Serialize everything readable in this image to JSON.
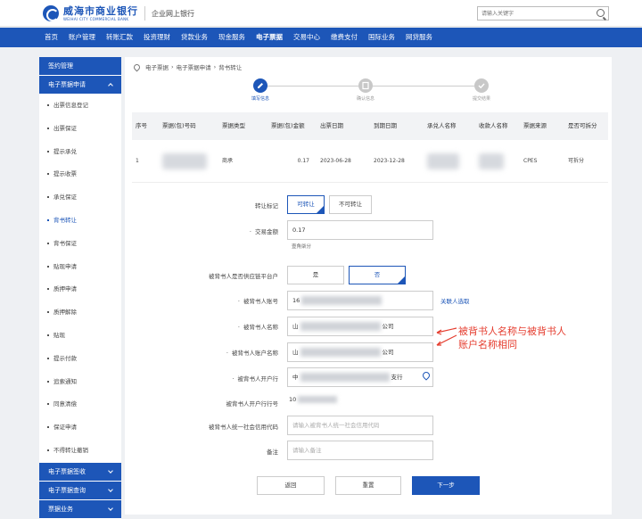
{
  "header": {
    "logo_cn": "威海市商业银行",
    "logo_en": "WEIHAI CITY COMMERCIAL BANK",
    "subtitle": "企业网上银行",
    "search_placeholder": "请输入关键字"
  },
  "nav": [
    "首页",
    "账户管理",
    "转账汇款",
    "投资理财",
    "贷款业务",
    "现金服务",
    "电子票据",
    "交易中心",
    "缴费支付",
    "国际业务",
    "网贷服务"
  ],
  "sidebar": {
    "section_sign": "签约管理",
    "section_apply": "电子票据申请",
    "items": [
      "出票信息登记",
      "出票保证",
      "提示承兑",
      "提示收票",
      "承兑保证",
      "背书转让",
      "背书保证",
      "贴现申请",
      "质押申请",
      "质押解除",
      "贴现",
      "提示付款",
      "追索通知",
      "同意清偿",
      "保证申请",
      "不得转让撤销"
    ],
    "section_sign2": "电子票据签收",
    "section_query": "电子票据查询",
    "section_more": "票据业务"
  },
  "breadcrumb": [
    "电子票据",
    "电子票据申请",
    "背书转让"
  ],
  "steps": [
    "填写信息",
    "确认信息",
    "提交结果"
  ],
  "table": {
    "headers": [
      "序号",
      "票据(包)号码",
      "票据类型",
      "票据(包)金额",
      "出票日期",
      "到期日期",
      "承兑人名称",
      "收款人名称",
      "票据来源",
      "是否可拆分"
    ],
    "row": {
      "seq": "1",
      "bill_type": "商承",
      "amount": "0.17",
      "issue_date": "2023-06-28",
      "due_date": "2023-12-28",
      "source": "CPES",
      "splittable": "可拆分"
    }
  },
  "form": {
    "transfer_mark_label": "转让标记",
    "transfer_yes": "可转让",
    "transfer_no": "不可转让",
    "amount_label": "交易金额",
    "amount_value": "0.17",
    "amount_hint": "壹角柒分",
    "platform_label": "被背书人是否供应链平台户",
    "platform_yes": "是",
    "platform_no": "否",
    "acct_no_label": "被背书人账号",
    "acct_no_value": "16",
    "contact_link": "关联人选取",
    "name_label": "被背书人名称",
    "name_prefix": "山",
    "name_suffix": "公司",
    "acct_name_label": "被背书人账户名称",
    "acct_name_prefix": "山",
    "acct_name_suffix": "公司",
    "bank_label": "被背书人开户行",
    "bank_prefix": "中",
    "bank_suffix": "支行",
    "bank_code_label": "被背书人开户行行号",
    "bank_code_value": "10",
    "credit_code_label": "被背书人统一社会信用代码",
    "credit_code_placeholder": "请输入被背书人统一社会信用代码",
    "remark_label": "备注",
    "remark_placeholder": "请输入备注"
  },
  "annotation": [
    "被背书人名称与被背书人",
    "账户名称相同"
  ],
  "buttons": {
    "back": "返回",
    "reset": "重置",
    "next": "下一步"
  },
  "colors": {
    "primary": "#1d56b8",
    "annotation": "#e53d2f"
  }
}
